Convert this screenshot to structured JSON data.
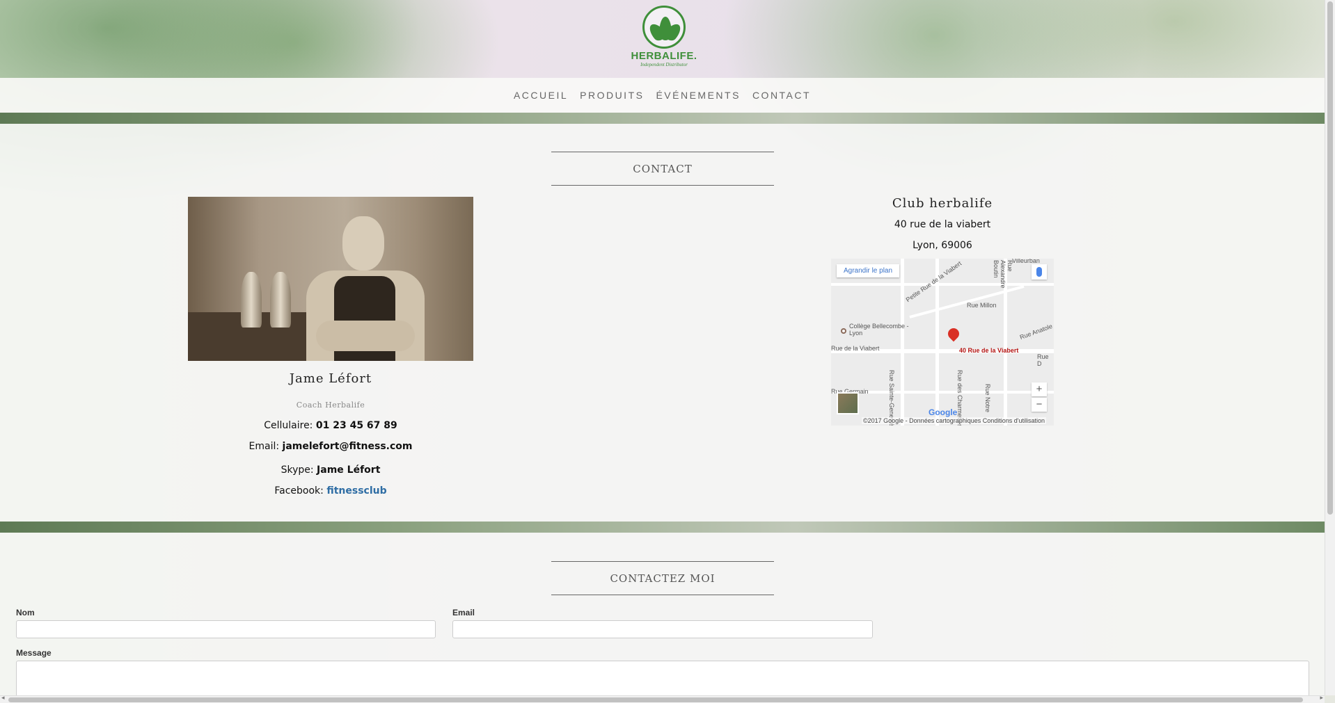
{
  "logo": {
    "brand": "HERBALIFE.",
    "tagline": "Independent Distributor"
  },
  "nav": {
    "items": [
      "ACCUEIL",
      "PRODUITS",
      "ÉVÉNEMENTS",
      "CONTACT"
    ]
  },
  "contact_section": {
    "title": "CONTACT",
    "person": {
      "name": "Jame Léfort",
      "role": "Coach Herbalife",
      "cell_label": "Cellulaire:",
      "cell_value": "01 23 45 67 89",
      "email_label": "Email:",
      "email_value": "jamelefort@fitness.com",
      "skype_label": "Skype:",
      "skype_value": "Jame Léfort",
      "facebook_label": "Facebook:",
      "facebook_value": "fitnessclub"
    },
    "club": {
      "name": "Club herbalife",
      "address": "40 rue de la viabert",
      "city": "Lyon, 69006"
    },
    "map": {
      "enlarge_label": "Agrandir le plan",
      "pin_label": "40 Rue de la Viabert",
      "street_labels": [
        "Petite Rue de la Viabert",
        "Rue Millon",
        "Rue Alexandre Boutin",
        "Rue Anatole",
        "Rue de la Viabert",
        "Rue Sainte-Geneviève",
        "Rue des Charmettes",
        "Rue Notre",
        "Collège Bellecombe - Lyon",
        "Rue Germain",
        "Rue D",
        "Villeurban"
      ],
      "zoom_in": "+",
      "zoom_out": "−",
      "google": "Google",
      "copyright": "©2017 Google - Données cartographiques",
      "terms": "Conditions d'utilisation"
    }
  },
  "form_section": {
    "title": "CONTACTEZ MOI",
    "nom_label": "Nom",
    "email_label": "Email",
    "message_label": "Message",
    "nom_value": "",
    "email_value": "",
    "message_value": ""
  },
  "colors": {
    "brand_green": "#3f8f3a",
    "link_blue": "#2e6da4",
    "map_pin": "#d93025"
  }
}
